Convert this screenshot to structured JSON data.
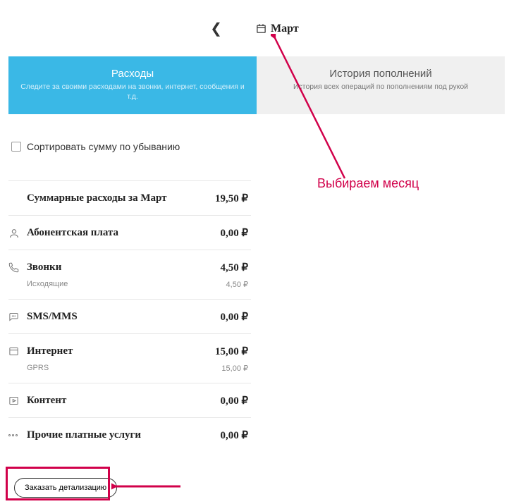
{
  "monthPicker": {
    "current": "Март"
  },
  "tabs": {
    "expenses": {
      "title": "Расходы",
      "subtitle": "Следите за своими расходами на звонки, интернет, сообщения и т.д."
    },
    "history": {
      "title": "История пополнений",
      "subtitle": "История всех операций по пополнениям под рукой"
    }
  },
  "sort": {
    "label": "Сортировать сумму по убыванию"
  },
  "summary": {
    "label": "Суммарные расходы за Март",
    "value": "19,50 ₽"
  },
  "rows": {
    "subscription": {
      "label": "Абонентская плата",
      "value": "0,00 ₽"
    },
    "calls": {
      "label": "Звонки",
      "value": "4,50 ₽",
      "sub": {
        "label": "Исходящие",
        "value": "4,50 ₽"
      }
    },
    "sms": {
      "label": "SMS/MMS",
      "value": "0,00 ₽"
    },
    "internet": {
      "label": "Интернет",
      "value": "15,00 ₽",
      "sub": {
        "label": "GPRS",
        "value": "15,00 ₽"
      }
    },
    "content": {
      "label": "Контент",
      "value": "0,00 ₽"
    },
    "other": {
      "label": "Прочие платные услуги",
      "value": "0,00 ₽"
    }
  },
  "orderBtn": "Заказать детализацию",
  "annotation": {
    "text": "Выбираем месяц"
  }
}
